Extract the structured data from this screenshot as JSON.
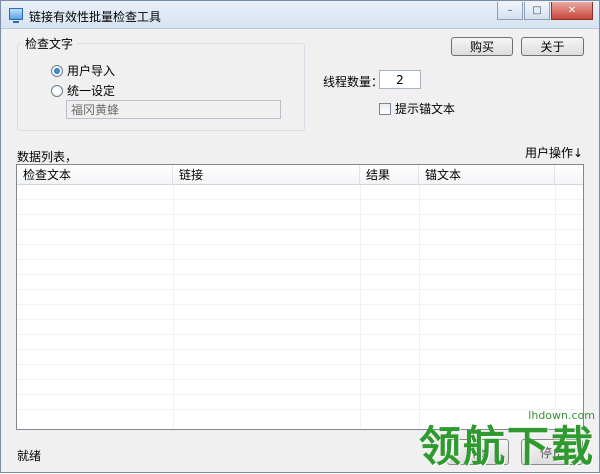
{
  "window": {
    "title": "链接有效性批量检查工具",
    "controls": {
      "minimize": "–",
      "maximize": "□",
      "close": "✕"
    }
  },
  "check_text_group": {
    "title": "检查文字",
    "options": [
      {
        "label": "用户导入",
        "checked": true
      },
      {
        "label": "统一设定",
        "checked": false
      }
    ],
    "input_value": "福冈黄蜂"
  },
  "buttons": {
    "buy": "购买",
    "about": "关于"
  },
  "threads": {
    "label": "线程数量：",
    "value": "2"
  },
  "show_anchor": {
    "label": "提示锚文本",
    "checked": false
  },
  "list": {
    "title": "数据列表，",
    "user_ops": "用户操作↓",
    "columns": [
      "检查文本",
      "链接",
      "结果",
      "锚文本"
    ]
  },
  "status": "就绪",
  "footer": {
    "start": "开始",
    "stop": "停止"
  },
  "watermark": {
    "brand": "领航下载",
    "url": "lhdown.com"
  }
}
